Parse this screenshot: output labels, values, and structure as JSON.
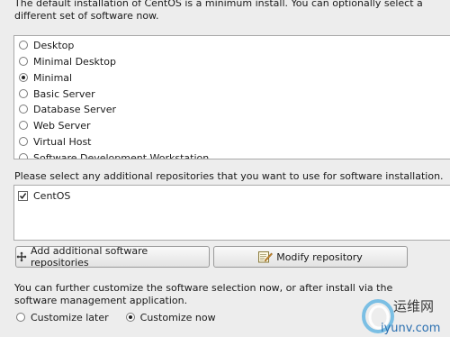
{
  "intro": {
    "text": "The default installation of CentOS is a minimum install. You can optionally select a different set of software now."
  },
  "software_options": [
    {
      "label": "Desktop",
      "selected": false
    },
    {
      "label": "Minimal Desktop",
      "selected": false
    },
    {
      "label": "Minimal",
      "selected": true
    },
    {
      "label": "Basic Server",
      "selected": false
    },
    {
      "label": "Database Server",
      "selected": false
    },
    {
      "label": "Web Server",
      "selected": false
    },
    {
      "label": "Virtual Host",
      "selected": false
    },
    {
      "label": "Software Development Workstation",
      "selected": false
    }
  ],
  "repositories": {
    "prompt": "Please select any additional repositories that you want to use for software installation.",
    "items": [
      {
        "label": "CentOS",
        "checked": true
      }
    ]
  },
  "buttons": {
    "add": "Add additional software repositories",
    "modify": "Modify repository",
    "add_icon": "add-icon",
    "modify_icon": "edit-icon"
  },
  "customize": {
    "text": "You can further customize the software selection now, or after install via the software management application.",
    "options": [
      {
        "label": "Customize later",
        "selected": false
      },
      {
        "label": "Customize now",
        "selected": true
      }
    ]
  },
  "watermark": {
    "cn": "运维网",
    "url": "iyunv.com"
  }
}
